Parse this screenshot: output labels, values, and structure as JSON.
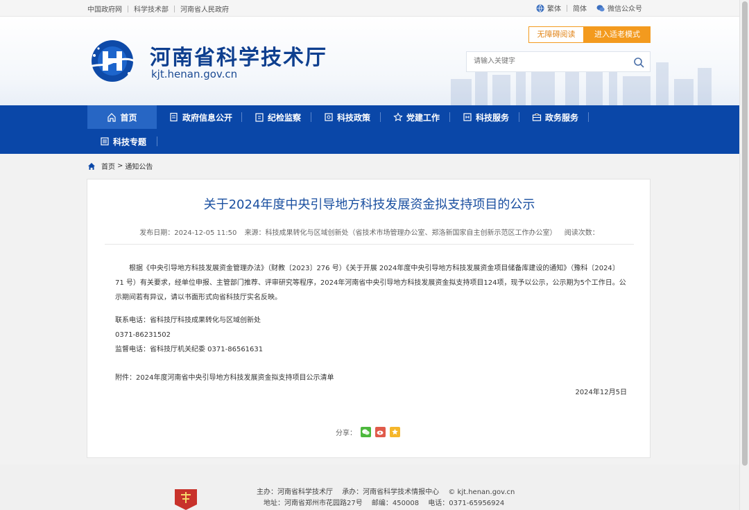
{
  "topbar": {
    "links": [
      "中国政府网",
      "科学技术部",
      "河南省人民政府"
    ],
    "traditional": "繁体",
    "simplified": "简体",
    "wechat": "微信公众号"
  },
  "header": {
    "title": "河南省科学技术厅",
    "url": "kjt.henan.gov.cn",
    "accessibility_label": "无障碍阅读",
    "elder_mode_label": "进入适老模式",
    "search_placeholder": "请输入关键字"
  },
  "nav": {
    "items": [
      "首页",
      "政府信息公开",
      "纪检监察",
      "科技政策",
      "党建工作",
      "科技服务",
      "政务服务",
      "科技专题"
    ]
  },
  "breadcrumb": {
    "home": "首页",
    "sep": ">",
    "current": "通知公告"
  },
  "article": {
    "title": "关于2024年度中央引导地方科技发展资金拟支持项目的公示",
    "publish_date": "发布日期：2024-12-05 11:50",
    "source": "来源：科技成果转化与区域创新处（省技术市场管理办公室、郑洛新国家自主创新示范区工作办公室）",
    "views": "阅读次数：",
    "paragraph": "根据《中央引导地方科技发展资金管理办法》（财教〔2023〕276 号）《关于开展 2024年度中央引导地方科技发展资金项目储备库建设的通知》（豫科〔2024〕71 号）有关要求，经单位申报、主管部门推荐、评审研究等程序，2024年河南省中央引导地方科技发展资金拟支持项目124项，现予以公示，公示期为5个工作日。公示期间若有异议，请以书面形式向省科技厅实名反映。",
    "contact_label": "联系电话：省科技厅科技成果转化与区域创新处",
    "contact_phone": "0371-86231502",
    "supervision": "监督电话：省科技厅机关纪委 0371-86561631",
    "attachment": "附件：2024年度河南省中央引导地方科技发展资金拟支持项目公示清单",
    "date": "2024年12月5日",
    "share_label": "分享："
  },
  "footer": {
    "host": "主办：河南省科学技术厅",
    "organizer": "承办：河南省科学技术情报中心",
    "copyright": "© kjt.henan.gov.cn",
    "address": "地址：河南省郑州市花园路27号",
    "postcode": "邮编：450008",
    "phone": "电话：0371-65956924"
  },
  "colors": {
    "nav_blue": "#0a47a8",
    "title_blue": "#1a4fa0",
    "orange": "#f39a1e"
  }
}
